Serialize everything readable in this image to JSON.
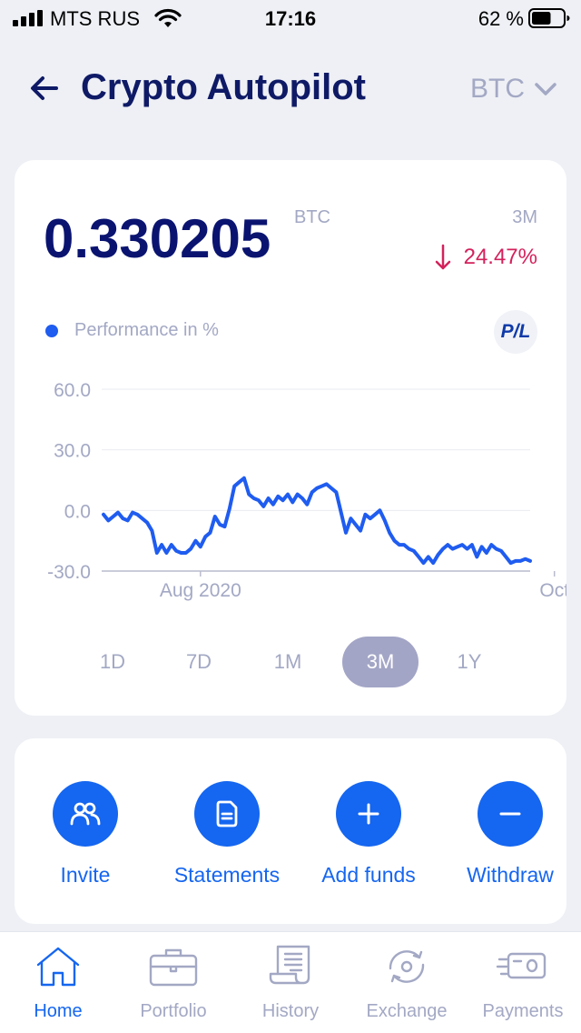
{
  "status_bar": {
    "carrier": "MTS RUS",
    "time": "17:16",
    "battery_percent": "62 %",
    "battery_level": 0.62
  },
  "header": {
    "title": "Crypto Autopilot",
    "currency": "BTC",
    "icons": {
      "back": "arrow-left-icon",
      "dropdown": "chevron-down-icon"
    }
  },
  "summary": {
    "balance": "0.330205",
    "unit": "BTC",
    "period": "3M",
    "change": "24.47%",
    "change_direction": "down",
    "change_color": "#d4215c"
  },
  "legend": {
    "label": "Performance in %",
    "color": "#1f5cf0"
  },
  "pl_button": "P/L",
  "chart_data": {
    "type": "line",
    "ylim": [
      -30,
      60
    ],
    "yticks": [
      "60.0",
      "30.0",
      "0.0",
      "-30.0"
    ],
    "ytick_values": [
      60,
      30,
      0,
      -30
    ],
    "xticks": [
      {
        "label": "Aug 2020",
        "index": 20
      },
      {
        "label": "Oct",
        "index": 93
      }
    ],
    "grid": true,
    "series": [
      {
        "color": "#1f5cf0",
        "values": [
          -2,
          -5,
          -3,
          -1,
          -4,
          -5,
          -1,
          -2,
          -4,
          -6,
          -10,
          -21,
          -17,
          -21,
          -17,
          -20,
          -21,
          -21,
          -19,
          -15,
          -18,
          -13,
          -11,
          -3,
          -7,
          -8,
          1,
          12,
          14,
          16,
          8,
          6,
          5,
          2,
          6,
          3,
          7,
          5,
          8,
          4,
          8,
          6,
          3,
          9,
          11,
          12,
          13,
          11,
          9,
          -1,
          -11,
          -4,
          -7,
          -10,
          -2,
          -4,
          -2,
          0,
          -5,
          -11,
          -15,
          -17,
          -17,
          -19,
          -20,
          -23,
          -26,
          -23,
          -26,
          -22,
          -19,
          -17,
          -19,
          -18,
          -17,
          -19,
          -17,
          -23,
          -18,
          -21,
          -17,
          -19,
          -20,
          -23,
          -26,
          -25,
          -25,
          -24,
          -25
        ]
      }
    ]
  },
  "periods": [
    {
      "label": "1D",
      "active": false
    },
    {
      "label": "7D",
      "active": false
    },
    {
      "label": "1M",
      "active": false
    },
    {
      "label": "3M",
      "active": true
    },
    {
      "label": "1Y",
      "active": false
    }
  ],
  "actions": [
    {
      "label": "Invite",
      "icon": "people-icon"
    },
    {
      "label": "Statements",
      "icon": "document-icon"
    },
    {
      "label": "Add funds",
      "icon": "plus-icon"
    },
    {
      "label": "Withdraw",
      "icon": "minus-icon"
    }
  ],
  "tabs": [
    {
      "label": "Home",
      "icon": "home-icon",
      "active": true
    },
    {
      "label": "Portfolio",
      "icon": "briefcase-icon",
      "active": false
    },
    {
      "label": "History",
      "icon": "receipt-icon",
      "active": false
    },
    {
      "label": "Exchange",
      "icon": "exchange-icon",
      "active": false
    },
    {
      "label": "Payments",
      "icon": "payments-icon",
      "active": false
    }
  ],
  "colors": {
    "accent": "#1566f0",
    "title": "#0f1a66",
    "muted": "#a3a8c4",
    "negative": "#d4215c",
    "active_period_bg": "#a3a5c6"
  }
}
